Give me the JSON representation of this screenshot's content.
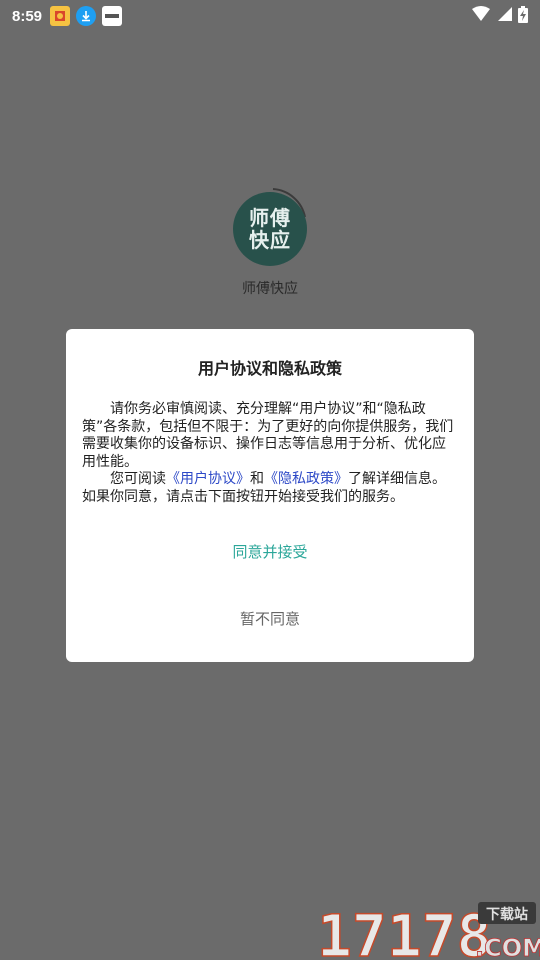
{
  "status_bar": {
    "time": "8:59",
    "icons": [
      "app-notification-icon",
      "download-icon",
      "app-notification-icon-2",
      "wifi-icon",
      "signal-icon",
      "battery-charging-icon"
    ]
  },
  "app": {
    "logo_line1": "师傅",
    "logo_line2": "快应",
    "name": "师傅快应"
  },
  "dialog": {
    "title": "用户协议和隐私政策",
    "paragraph1": "请你务必审慎阅读、充分理解“用户协议”和“隐私政策”各条款，包括但不限于：为了更好的向你提供服务，我们需要收集你的设备标识、操作日志等信息用于分析、优化应用性能。",
    "p2_prefix": "您可阅读",
    "p2_link1": "《用户协议》",
    "p2_and": "和",
    "p2_link2": "《隐私政策》",
    "p2_suffix": "了解详细信息。如果你同意，请点击下面按钮开始接受我们的服务。",
    "agree_label": "同意并接受",
    "disagree_label": "暂不同意"
  },
  "watermark": {
    "number": "17178",
    "tag": "下载站",
    "domain": ".COM"
  },
  "colors": {
    "overlay": "#6b6b6b",
    "accent": "#2ca79a",
    "link": "#2d49c7",
    "logo_bg": "#28514b"
  }
}
